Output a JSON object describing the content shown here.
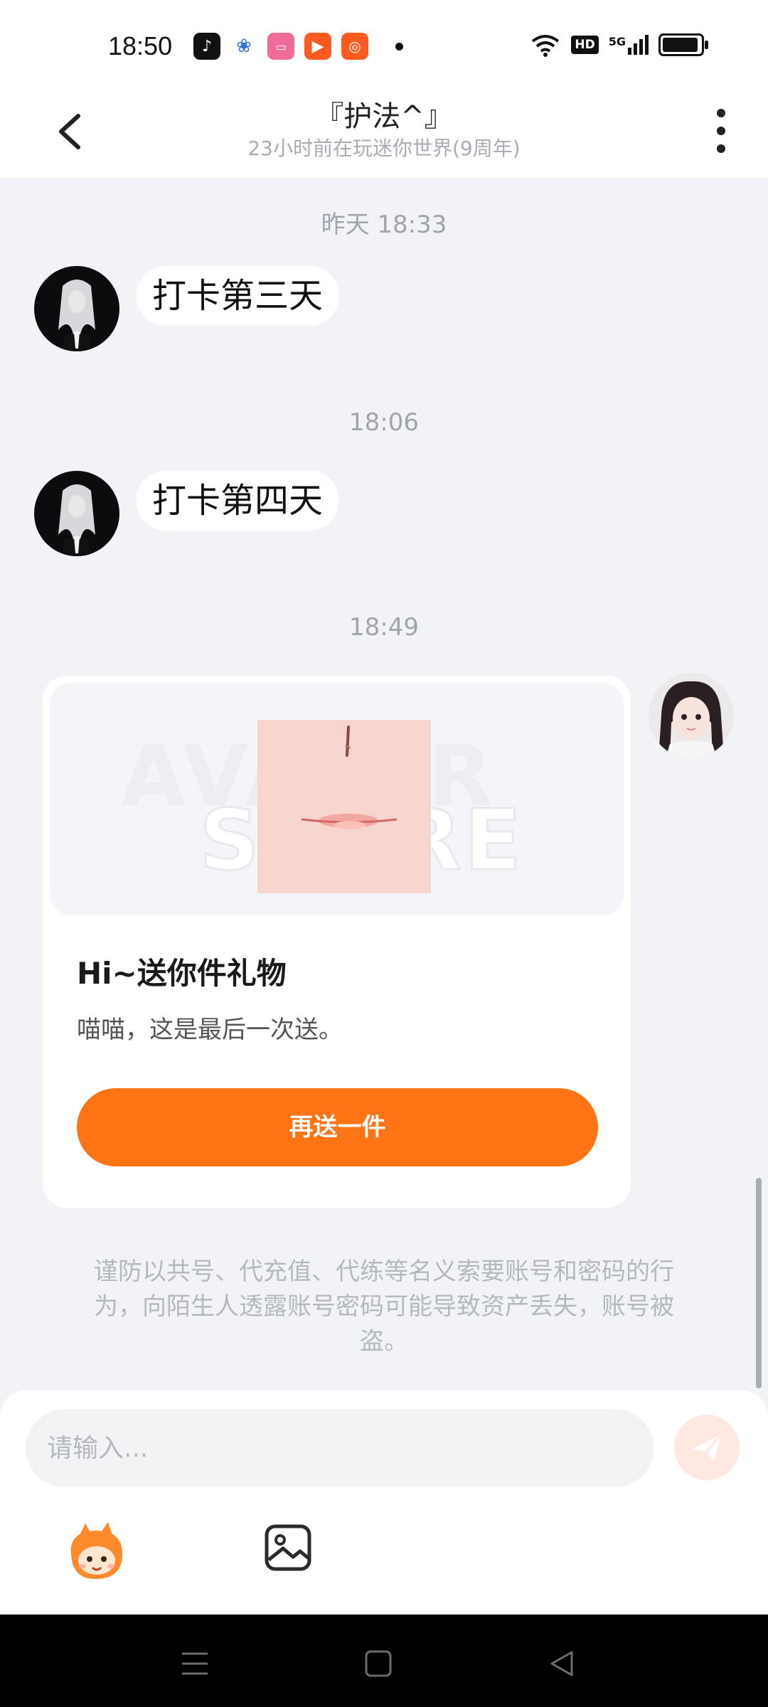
{
  "status_bar": {
    "time": "18:50",
    "app_icons": [
      "tiktok-icon",
      "baidu-icon",
      "bilibili-icon",
      "video-player-icon",
      "kuaishou-icon"
    ],
    "indicators": [
      "wifi-icon",
      "hd-icon",
      "5g-signal-icon",
      "battery-icon"
    ],
    "hd_label": "HD",
    "network_label": "5G",
    "battery_level": 0.95
  },
  "header": {
    "title": "『护法^』",
    "subtitle": "23小时前在玩迷你世界(9周年)"
  },
  "messages": [
    {
      "time": "昨天 18:33",
      "text": "打卡第三天"
    },
    {
      "time": "18:06",
      "text": "打卡第四天"
    }
  ],
  "gift_card": {
    "time": "18:49",
    "watermark_top": "AVATAR",
    "watermark_bottom": "STORE",
    "title": "Hi~送你件礼物",
    "description": "喵喵，这是最后一次送。",
    "button_label": "再送一件"
  },
  "warning": "谨防以共号、代充值、代练等名义索要账号和密码的行为，向陌生人透露账号密码可能导致资产丢失，账号被盗。",
  "input": {
    "placeholder": "请输入..."
  },
  "colors": {
    "accent": "#ff7415",
    "background": "#f1f3f7",
    "send_button": "#ffe7e2"
  }
}
